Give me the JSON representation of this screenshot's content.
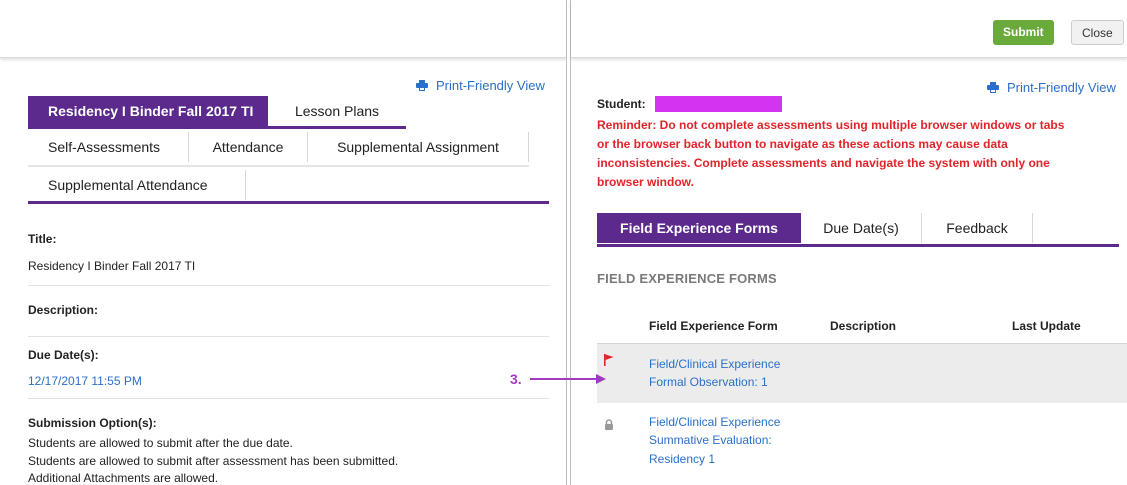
{
  "left": {
    "print_label": "Print-Friendly View",
    "tabs_row1": [
      {
        "label": "Residency I Binder Fall 2017 TI",
        "active": true
      },
      {
        "label": "Lesson Plans",
        "active": false
      }
    ],
    "tabs_row2": [
      {
        "label": "Self-Assessments"
      },
      {
        "label": "Attendance"
      },
      {
        "label": "Supplemental Assignment"
      }
    ],
    "tabs_row3": [
      {
        "label": "Supplemental Attendance"
      }
    ],
    "title_label": "Title:",
    "title_value": "Residency I Binder Fall 2017 TI",
    "description_label": "Description:",
    "due_label": "Due Date(s):",
    "due_value": "12/17/2017 11:55 PM",
    "submission_label": "Submission Option(s):",
    "submission_lines": [
      "Students are allowed to submit after the due date.",
      "Students are allowed to submit after assessment has been submitted.",
      "Additional Attachments are allowed."
    ]
  },
  "right": {
    "submit_label": "Submit",
    "close_label": "Close",
    "print_label": "Print-Friendly View",
    "student_label": "Student:",
    "reminder_lines": [
      "Reminder: Do not complete assessments using multiple browser windows or tabs",
      "or the browser back button to navigate as these actions may cause data",
      "inconsistencies. Complete assessments and navigate the system with only one",
      "browser window."
    ],
    "tabs": [
      {
        "label": "Field Experience Forms",
        "active": true
      },
      {
        "label": "Due Date(s)",
        "active": false
      },
      {
        "label": "Feedback",
        "active": false
      }
    ],
    "section_heading": "FIELD EXPERIENCE FORMS",
    "columns": [
      "Field Experience Form",
      "Description",
      "Last Update"
    ],
    "rows": [
      {
        "icon": "flag-icon",
        "lines": [
          "Field/Clinical Experience",
          "Formal Observation: 1"
        ]
      },
      {
        "icon": "lock-icon",
        "lines": [
          "Field/Clinical Experience",
          "Summative Evaluation:",
          "Residency 1"
        ]
      }
    ],
    "annotation": "3."
  },
  "colors": {
    "accent": "#5b2a8c",
    "link": "#2a6fc9",
    "alert": "#e0242a",
    "submit": "#6aaa3a",
    "annotation": "#a23bbf",
    "redaction": "#d433f0"
  }
}
